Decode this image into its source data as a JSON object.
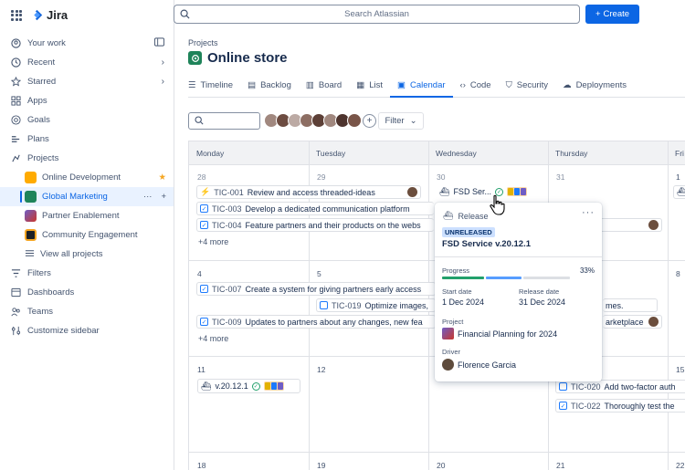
{
  "app": {
    "name": "Jira"
  },
  "colors": {
    "accent": "#0c66e4",
    "success": "#22a06b",
    "release_badge": "#cce0ff"
  },
  "topbar": {
    "search_placeholder": "Search Atlassian",
    "create_label": "Create"
  },
  "sidebar": {
    "items": [
      {
        "label": "Your work",
        "icon": "user-icon",
        "trail": "collapse-icon"
      },
      {
        "label": "Recent",
        "icon": "clock-icon",
        "trail": "chevron-right-icon"
      },
      {
        "label": "Starred",
        "icon": "star-icon",
        "trail": "chevron-right-icon"
      },
      {
        "label": "Apps",
        "icon": "apps-icon"
      },
      {
        "label": "Goals",
        "icon": "goal-icon"
      },
      {
        "label": "Plans",
        "icon": "plans-icon"
      },
      {
        "label": "Projects",
        "icon": "projects-icon"
      }
    ],
    "projects": [
      {
        "label": "Online Development",
        "color": "#2684ff",
        "starred": true
      },
      {
        "label": "Global Marketing",
        "color": "#1f845a",
        "active": true
      },
      {
        "label": "Partner Enablement",
        "color": "#6e5dc6"
      },
      {
        "label": "Community Engagement",
        "color": "#1d2125"
      }
    ],
    "view_all": "View all projects",
    "bottom_items": [
      {
        "label": "Filters",
        "icon": "filter-icon"
      },
      {
        "label": "Dashboards",
        "icon": "dashboard-icon"
      },
      {
        "label": "Teams",
        "icon": "teams-icon"
      },
      {
        "label": "Customize sidebar",
        "icon": "customize-icon"
      }
    ]
  },
  "header": {
    "breadcrumb": "Projects",
    "title": "Online store"
  },
  "tabs": [
    "Timeline",
    "Backlog",
    "Board",
    "List",
    "Calendar",
    "Code",
    "Security",
    "Deployments"
  ],
  "toolbar": {
    "filter_label": "Filter"
  },
  "calendar": {
    "days": [
      "Monday",
      "Tuesday",
      "Wednesday",
      "Thursday",
      "Fri"
    ],
    "weeks": [
      [
        "28",
        "29",
        "30",
        "31",
        "1"
      ],
      [
        "4",
        "5",
        "6",
        "7",
        "8"
      ],
      [
        "11",
        "12",
        "13",
        "14",
        "15"
      ],
      [
        "18",
        "19",
        "20",
        "21",
        "22"
      ]
    ],
    "events": {
      "e1": {
        "key": "TIC-001",
        "title": "Review and access threaded-ideas"
      },
      "e2": {
        "key": "TIC-003",
        "title": "Develop a dedicated communication platform"
      },
      "e3": {
        "key": "TIC-004",
        "title": "Feature partners and their products on the webs"
      },
      "e4": {
        "key": "TIC-007",
        "title": "Create a system for giving partners early access"
      },
      "e5": {
        "key": "TIC-019",
        "title": "Optimize images,"
      },
      "e6": {
        "key": "TIC-009",
        "title": "Updates to partners about any changes, new fea"
      },
      "e7": {
        "key": "TIC-020",
        "title": "Add two-factor auth"
      },
      "e8": {
        "key": "TIC-022",
        "title": "Thoroughly test the"
      }
    },
    "more_1": "+4 more",
    "more_2": "+4 more",
    "fragments": {
      "mes": "mes.",
      "marketplace": "arketplace"
    },
    "release_wed": "FSD Ser...",
    "release_mon": "v.20.12.1"
  },
  "popup": {
    "header": "Release",
    "status": "UNRELEASED",
    "title": "FSD Service v.20.12.1",
    "progress_label": "Progress",
    "progress": 0.33,
    "progress_text": "33%",
    "start_label": "Start date",
    "start": "1 Dec 2024",
    "release_label": "Release date",
    "release": "31 Dec 2024",
    "project_label": "Project",
    "project": "Financial Planning for 2024",
    "driver_label": "Driver",
    "driver": "Florence Garcia"
  }
}
